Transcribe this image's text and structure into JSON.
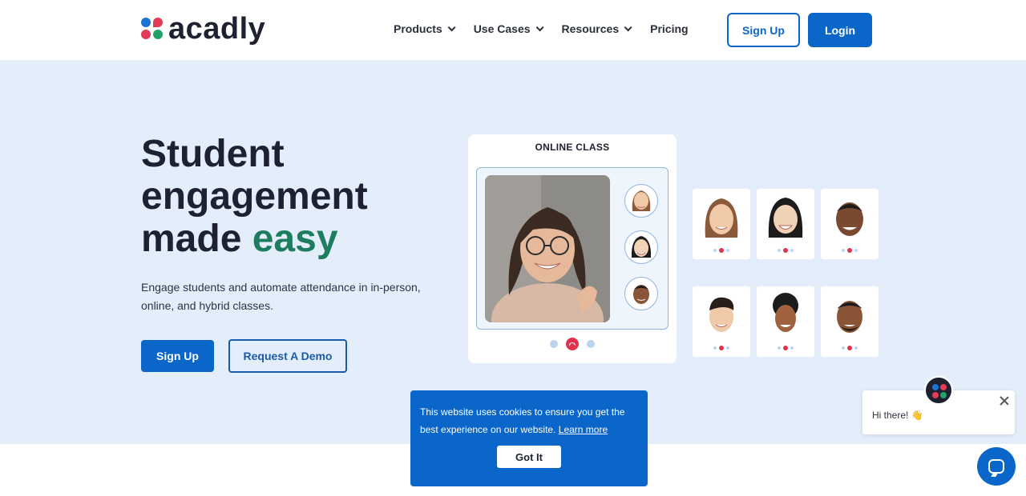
{
  "header": {
    "brand": "acadly",
    "nav": [
      {
        "label": "Products",
        "has_dropdown": true
      },
      {
        "label": "Use Cases",
        "has_dropdown": true
      },
      {
        "label": "Resources",
        "has_dropdown": true
      },
      {
        "label": "Pricing",
        "has_dropdown": false
      }
    ],
    "signup_label": "Sign Up",
    "login_label": "Login"
  },
  "hero": {
    "title_line1": "Student",
    "title_line2": "engagement",
    "title_line3_prefix": "made ",
    "title_line3_accent": "easy",
    "subtitle": "Engage students and automate attendance in in-person, online, and hybrid classes.",
    "signup_label": "Sign Up",
    "demo_label": "Request A Demo"
  },
  "online_class": {
    "title": "ONLINE CLASS"
  },
  "cookie": {
    "text": "This website uses cookies to ensure you get the best experience on our website.",
    "link_label": "Learn more",
    "button_label": "Got It"
  },
  "chat": {
    "message": "Hi there! 👋"
  },
  "colors": {
    "primary": "#0a66c8",
    "accent_green": "#1d7d5e",
    "hero_bg": "#e4eefb",
    "end_call": "#e0344e"
  },
  "icons": [
    "chevron-down-icon",
    "end-call-icon",
    "close-icon",
    "chat-icon",
    "acadly-logo-icon"
  ]
}
